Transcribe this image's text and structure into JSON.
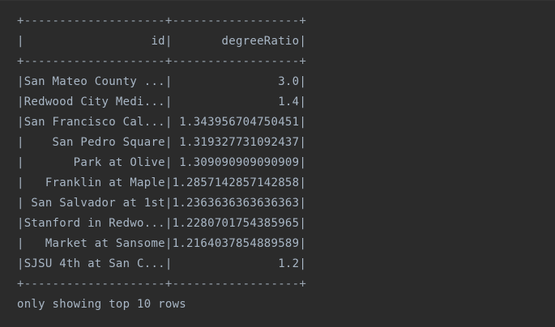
{
  "output": {
    "border_line": "+--------------------+------------------+",
    "header_line": "|                  id|       degreeRatio|",
    "rows": [
      "|San Mateo County ...|               3.0|",
      "|Redwood City Medi...|               1.4|",
      "|San Francisco Cal...| 1.343956704750451|",
      "|    San Pedro Square| 1.319327731092437|",
      "|       Park at Olive| 1.309090909090909|",
      "|   Franklin at Maple|1.2857142857142858|",
      "| San Salvador at 1st|1.2363636363636363|",
      "|Stanford in Redwo...|1.2280701754385965|",
      "|   Market at Sansome|1.2164037854889589|",
      "|SJSU 4th at San C...|               1.2|"
    ],
    "footer": "only showing top 10 rows"
  },
  "colors": {
    "background": "#2b2b2b",
    "text": "#a9b7c6"
  }
}
